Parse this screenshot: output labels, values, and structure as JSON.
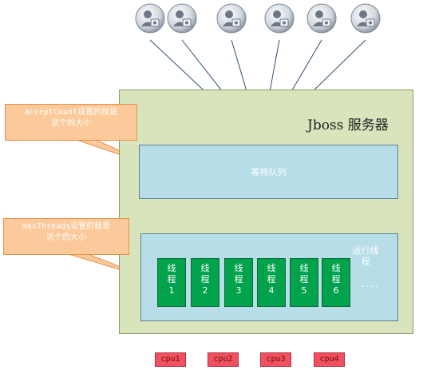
{
  "server": {
    "title": "Jboss 服务器"
  },
  "queue": {
    "label": "等待队列"
  },
  "pool": {
    "label": "运行线程",
    "dots": "...."
  },
  "threads": [
    {
      "line1": "线",
      "line2": "程",
      "num": "1"
    },
    {
      "line1": "线",
      "line2": "程",
      "num": "2"
    },
    {
      "line1": "线",
      "line2": "程",
      "num": "3"
    },
    {
      "line1": "线",
      "line2": "程",
      "num": "4"
    },
    {
      "line1": "线",
      "line2": "程",
      "num": "5"
    },
    {
      "line1": "线",
      "line2": "程",
      "num": "6"
    }
  ],
  "callouts": {
    "accept": {
      "line1": "acceptCount设置的就是",
      "line2": "这个的大小"
    },
    "max": {
      "line1": "maxThreads设置的就是",
      "line2": "这个的大小"
    }
  },
  "cpus": [
    "cpu1",
    "cpu2",
    "cpu3",
    "cpu4"
  ],
  "users": {
    "count": 6,
    "icon": "user-icon"
  },
  "colors": {
    "server_fill": "#d8e4bc",
    "queue_fill": "#b7dde8",
    "thread_fill": "#00a24b",
    "callout_fill": "#fbc99a",
    "cpu_fill": "#f05060",
    "wire": "#2f4f6f"
  }
}
